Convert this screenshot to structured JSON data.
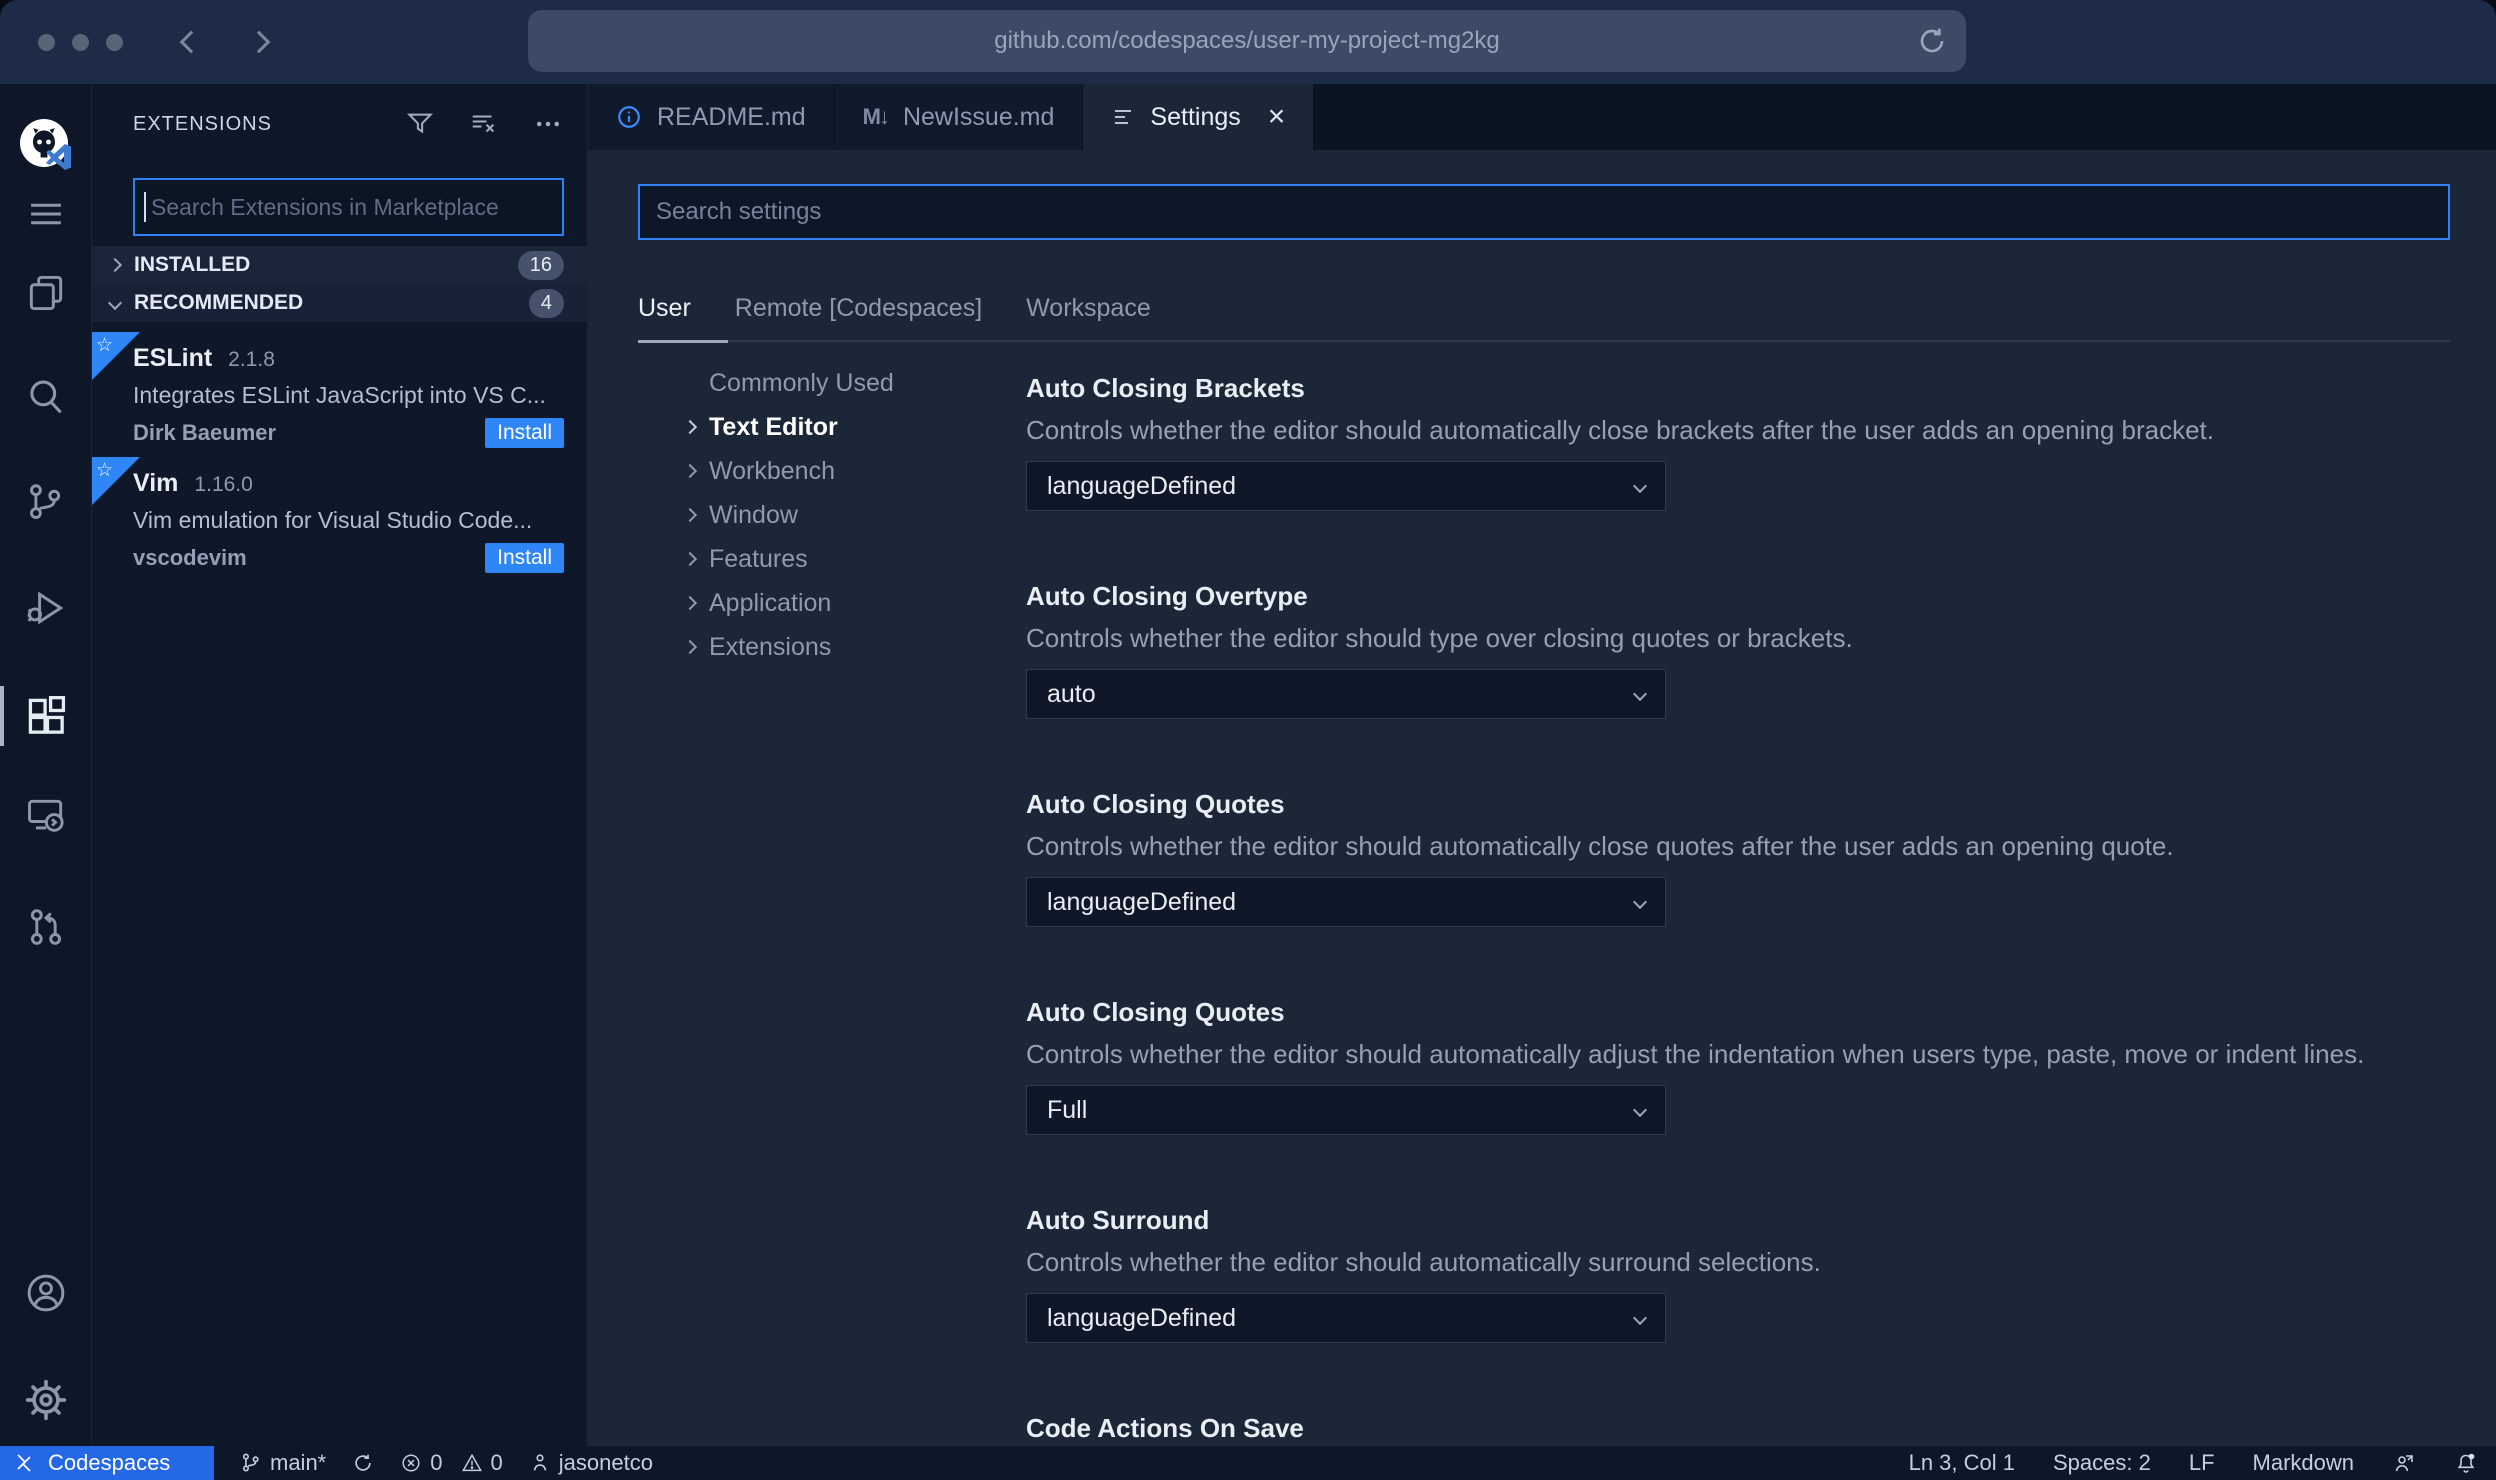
{
  "colors": {
    "accent_blue": "#2f81f7",
    "install_blue": "#2f86f6",
    "codespaces_blue": "#2468e8",
    "chrome_bg": "#1e2b46",
    "editor_bg": "#1b2637",
    "panel_bg": "#0e1828"
  },
  "browser": {
    "url": "github.com/codespaces/user-my-project-mg2kg",
    "icons": [
      "back-icon",
      "forward-icon",
      "reload-icon"
    ]
  },
  "activity_bar": {
    "items": [
      {
        "icon": "github-codespaces-logo"
      },
      {
        "icon": "menu-icon"
      },
      {
        "icon": "explorer-icon"
      },
      {
        "icon": "search-icon"
      },
      {
        "icon": "source-control-icon"
      },
      {
        "icon": "run-debug-icon"
      },
      {
        "icon": "extensions-icon",
        "active": true
      },
      {
        "icon": "remote-explorer-icon"
      },
      {
        "icon": "github-pr-icon"
      },
      {
        "icon": "account-icon"
      },
      {
        "icon": "settings-gear-icon"
      }
    ]
  },
  "sidebar": {
    "title": "EXTENSIONS",
    "header_icons": [
      "filter-icon",
      "clear-filter-icon",
      "more-actions-icon"
    ],
    "search": {
      "placeholder": "Search Extensions in Marketplace"
    },
    "sections": [
      {
        "label": "INSTALLED",
        "count": "16"
      },
      {
        "label": "RECOMMENDED",
        "count": "4"
      }
    ],
    "extensions": [
      {
        "name": "ESLint",
        "version": "2.1.8",
        "description": "Integrates ESLint JavaScript into VS C...",
        "publisher": "Dirk Baeumer",
        "action_label": "Install"
      },
      {
        "name": "Vim",
        "version": "1.16.0",
        "description": "Vim emulation for Visual Studio Code...",
        "publisher": "vscodevim",
        "action_label": "Install"
      }
    ]
  },
  "editor": {
    "tabs": [
      {
        "label": "README.md",
        "icon": "info-icon"
      },
      {
        "label": "NewIssue.md",
        "icon": "markdown-icon"
      },
      {
        "label": "Settings",
        "icon": "settings-editor-icon",
        "active": true,
        "close": "×"
      }
    ]
  },
  "settings": {
    "search": {
      "placeholder": "Search settings"
    },
    "scope_tabs": [
      {
        "label": "User",
        "active": true
      },
      {
        "label": "Remote [Codespaces]"
      },
      {
        "label": "Workspace"
      }
    ],
    "toc": [
      {
        "label": "Commonly Used"
      },
      {
        "label": "Text Editor",
        "active": true
      },
      {
        "label": "Workbench"
      },
      {
        "label": "Window"
      },
      {
        "label": "Features"
      },
      {
        "label": "Application"
      },
      {
        "label": "Extensions"
      }
    ],
    "entries": [
      {
        "title": "Auto Closing Brackets",
        "description": "Controls whether the editor should automatically close brackets after the user adds an opening bracket.",
        "value": "languageDefined"
      },
      {
        "title": "Auto Closing Overtype",
        "description": "Controls whether the editor should type over closing quotes or brackets.",
        "value": "auto"
      },
      {
        "title": "Auto Closing Quotes",
        "description": "Controls whether the editor should automatically close quotes after the user adds an opening quote.",
        "value": "languageDefined"
      },
      {
        "title": "Auto Closing Quotes",
        "description": "Controls whether the editor should automatically adjust the indentation when users type, paste, move or indent lines.",
        "value": "Full"
      },
      {
        "title": "Auto Surround",
        "description": "Controls whether the editor should automatically surround selections.",
        "value": "languageDefined"
      },
      {
        "title": "Code Actions On Save"
      }
    ]
  },
  "status_bar": {
    "left": {
      "codespaces_label": "Codespaces",
      "branch": "main*",
      "errors": "0",
      "warnings": "0",
      "user": "jasonetco"
    },
    "right": {
      "cursor": "Ln 3, Col 1",
      "indent": "Spaces: 2",
      "eol": "LF",
      "language": "Markdown"
    }
  }
}
